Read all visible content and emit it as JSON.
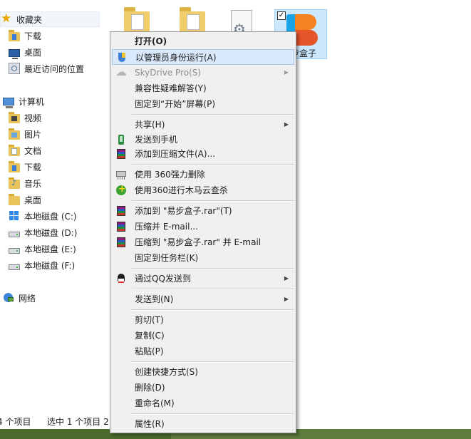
{
  "nav": {
    "favorites": {
      "label": "收藏夹",
      "items": [
        "下载",
        "桌面",
        "最近访问的位置"
      ]
    },
    "computer": {
      "label": "计算机",
      "items": [
        "视频",
        "图片",
        "文档",
        "下载",
        "音乐",
        "桌面"
      ]
    },
    "drives": [
      "本地磁盘 (C:)",
      "本地磁盘 (D:)",
      "本地磁盘 (E:)",
      "本地磁盘 (F:)"
    ],
    "network": "网络"
  },
  "files": {
    "selected_label": "易步盒子",
    "selected_checked": "✓"
  },
  "status": {
    "count": "4 个项目",
    "selection": "选中 1 个项目 2"
  },
  "menu": {
    "open": "打开(O)",
    "run_as_admin": "以管理员身份运行(A)",
    "skydrive": "SkyDrive Pro(S)",
    "troubleshoot": "兼容性疑难解答(Y)",
    "pin_start": "固定到“开始”屏幕(P)",
    "share": "共享(H)",
    "send_phone": "发送到手机",
    "add_archive": "添加到压缩文件(A)...",
    "delete_360": "使用 360强力删除",
    "scan_360": "使用360进行木马云查杀",
    "add_rar": "添加到 \"易步盒子.rar\"(T)",
    "compress_email": "压缩并 E-mail...",
    "compress_rar_email": "压缩到 \"易步盒子.rar\" 并 E-mail",
    "pin_taskbar": "固定到任务栏(K)",
    "send_qq": "通过QQ发送到",
    "send_to": "发送到(N)",
    "cut": "剪切(T)",
    "copy": "复制(C)",
    "paste": "粘贴(P)",
    "create_shortcut": "创建快捷方式(S)",
    "delete": "删除(D)",
    "rename": "重命名(M)",
    "properties": "属性(R)",
    "submenu_arrow": "▶"
  }
}
